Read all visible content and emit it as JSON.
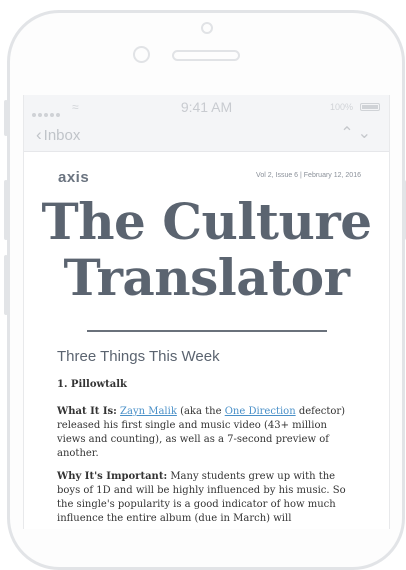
{
  "status_bar": {
    "time": "9:41 AM",
    "battery": "100%"
  },
  "nav": {
    "back_label": "Inbox"
  },
  "newsletter": {
    "logo": "axis",
    "issue_info": "Vol 2, Issue 6 | February 12, 2016",
    "title_line1": "The Culture",
    "title_line2": "Translator",
    "section_heading": "Three Things This Week",
    "item1_title": "1. Pillowtalk",
    "what_label": "What It Is:",
    "link_zayn": "Zayn Malik",
    "text_aka": " (aka the ",
    "link_1d": "One Direction",
    "text_rest": " defector) released his first single and music video (43+ million views and counting), as well as a 7-second preview of another.",
    "why_label": "Why It's Important:",
    "why_text": " Many students grew up with the boys of 1D and will be highly influenced by his music. So the single's popularity is a good indicator of how much influence the entire album (due in March) will"
  }
}
